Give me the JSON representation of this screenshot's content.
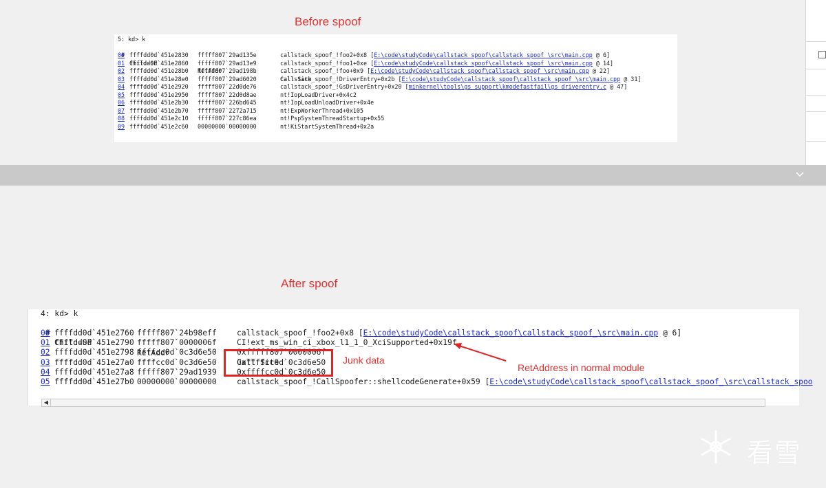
{
  "top_section": {
    "title": "Before spoof",
    "prompt": "5: kd> k",
    "headers": {
      "idx": " #",
      "child_sp": "Child-SP",
      "ret_addr": "RetAddr",
      "call_site": "Call Site"
    },
    "rows": [
      {
        "idx": "00",
        "sp": "ffffdd0d`451e2830",
        "ra": "fffff807`29ad135e",
        "cs": "callstack_spoof_!foo2+0x8 ",
        "src": "[E:\\code\\studyCode\\callstack_spoof\\callstack_spoof_\\src\\main.cpp",
        "tail": " @ 6]"
      },
      {
        "idx": "01",
        "sp": "ffffdd0d`451e2860",
        "ra": "fffff807`29ad13e9",
        "cs": "callstack_spoof_!foo1+0xe ",
        "src": "[E:\\code\\studyCode\\callstack_spoof\\callstack_spoof_\\src\\main.cpp",
        "tail": " @ 14]"
      },
      {
        "idx": "02",
        "sp": "ffffdd0d`451e28b0",
        "ra": "fffff807`29ad198b",
        "cs": "callstack_spoof_!foo+0x9 ",
        "src": "[E:\\code\\studyCode\\callstack_spoof\\callstack_spoof_\\src\\main.cpp",
        "tail": " @ 22]"
      },
      {
        "idx": "03",
        "sp": "ffffdd0d`451e28e0",
        "ra": "fffff807`29ad6020",
        "cs": "callstack_spoof_!DriverEntry+0x2b ",
        "src": "[E:\\code\\studyCode\\callstack_spoof\\callstack_spoof_\\src\\main.cpp",
        "tail": " @ 31]"
      },
      {
        "idx": "04",
        "sp": "ffffdd0d`451e2920",
        "ra": "fffff807`22d0de76",
        "cs": "callstack_spoof_!GsDriverEntry+0x20 ",
        "src": "[minkernel\\tools\\gs_support\\kmodefastfail\\gs_driverentry.c",
        "tail": " @ 47]"
      },
      {
        "idx": "05",
        "sp": "ffffdd0d`451e2950",
        "ra": "fffff807`22d0d8ae",
        "cs": "nt!IopLoadDriver+0x4c2",
        "src": "",
        "tail": ""
      },
      {
        "idx": "06",
        "sp": "ffffdd0d`451e2b30",
        "ra": "fffff807`226bd645",
        "cs": "nt!IopLoadUnloadDriver+0x4e",
        "src": "",
        "tail": ""
      },
      {
        "idx": "07",
        "sp": "ffffdd0d`451e2b70",
        "ra": "fffff807`2272a715",
        "cs": "nt!ExpWorkerThread+0x105",
        "src": "",
        "tail": ""
      },
      {
        "idx": "08",
        "sp": "ffffdd0d`451e2c10",
        "ra": "fffff807`227c86ea",
        "cs": "nt!PspSystemThreadStartup+0x55",
        "src": "",
        "tail": ""
      },
      {
        "idx": "09",
        "sp": "ffffdd0d`451e2c60",
        "ra": "00000000`00000000",
        "cs": "nt!KiStartSystemThread+0x2a",
        "src": "",
        "tail": ""
      }
    ]
  },
  "bottom_section": {
    "title": "After spoof",
    "prompt": "4: kd> k",
    "headers": {
      "idx": " #",
      "child_sp": "Child-SP",
      "ret_addr": "RetAddr",
      "call_site": "Call Site"
    },
    "rows": [
      {
        "idx": "00",
        "sp": "ffffdd0d`451e2760",
        "ra": "fffff807`24b98eff",
        "cs": "callstack_spoof_!foo2+0x8 ",
        "src": "[E:\\code\\studyCode\\callstack_spoof\\callstack_spoof_\\src\\main.cpp",
        "tail": " @ 6]"
      },
      {
        "idx": "01",
        "sp": "ffffdd0d`451e2790",
        "ra": "fffff807`0000006f",
        "cs": "CI!ext_ms_win_ci_xbox_l1_1_0_XciSupported+0x19f",
        "src": "",
        "tail": ""
      },
      {
        "idx": "02",
        "sp": "ffffdd0d`451e2798",
        "ra": "ffffcc0d`0c3d6e50",
        "cs": "0xfffff807`0000006f",
        "src": "",
        "tail": ""
      },
      {
        "idx": "03",
        "sp": "ffffdd0d`451e27a0",
        "ra": "ffffcc0d`0c3d6e50",
        "cs": "0xffffcc0d`0c3d6e50",
        "src": "",
        "tail": ""
      },
      {
        "idx": "04",
        "sp": "ffffdd0d`451e27a8",
        "ra": "fffff807`29ad1939",
        "cs": "0xffffcc0d`0c3d6e50",
        "src": "",
        "tail": ""
      },
      {
        "idx": "05",
        "sp": "ffffdd0d`451e27b0",
        "ra": "00000000`00000000",
        "cs": "callstack_spoof_!CallSpoofer::shellcodeGenerate+0x59 ",
        "src": "[E:\\code\\studyCode\\callstack_spoof\\callstack_spoof_\\src\\callstack_spoo",
        "tail": ""
      }
    ],
    "annotations": {
      "junk_data": "Junk data",
      "ret_address_note": "RetAddress in normal module"
    }
  },
  "watermark": {
    "text": "看雪"
  },
  "colors": {
    "annotation": "#e53030",
    "link": "#1b2bd8",
    "box": "#e02424"
  },
  "icons": {
    "collapse": "chevron-down-icon",
    "scroll_left": "scroll-left-icon",
    "watermark": "snowflake-logo-icon"
  }
}
